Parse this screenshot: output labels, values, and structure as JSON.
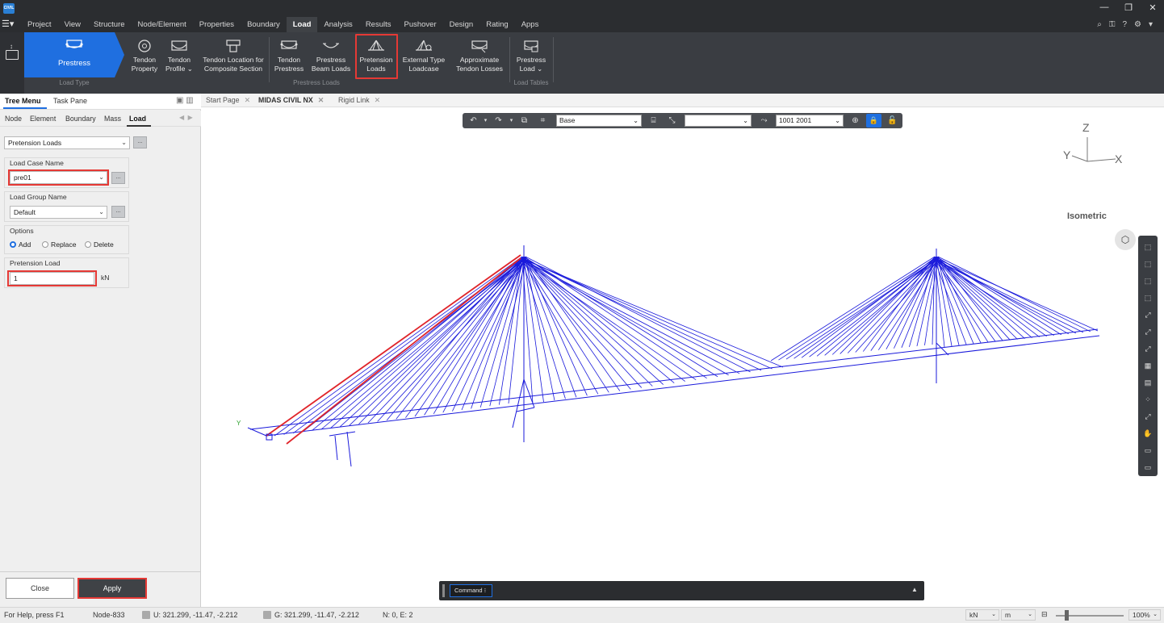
{
  "window": {
    "logo_text": "CIVIL",
    "controls": [
      "—",
      "❐",
      "✕"
    ]
  },
  "menu": {
    "tabs": [
      "Project",
      "View",
      "Structure",
      "Node/Element",
      "Properties",
      "Boundary",
      "Load",
      "Analysis",
      "Results",
      "Pushover",
      "Design",
      "Rating",
      "Apps"
    ],
    "active": "Load"
  },
  "ribbon": {
    "prestress": "Prestress",
    "load_type_group": "Load Type",
    "prestress_loads_group": "Prestress Loads",
    "load_tables_group": "Load Tables",
    "buttons": {
      "tendon_property": [
        "Tendon",
        "Property"
      ],
      "tendon_profile": [
        "Tendon",
        "Profile ⌄"
      ],
      "tendon_location": [
        "Tendon Location for",
        "Composite Section"
      ],
      "tendon_prestress": [
        "Tendon",
        "Prestress"
      ],
      "prestress_beam": [
        "Prestress",
        "Beam Loads"
      ],
      "pretension": [
        "Pretension",
        "Loads"
      ],
      "external_type": [
        "External Type",
        "Loadcase"
      ],
      "approx_losses": [
        "Approximate",
        "Tendon Losses"
      ],
      "prestress_load": [
        "Prestress",
        "Load ⌄"
      ]
    }
  },
  "left_panel": {
    "tabs": {
      "tree_menu": "Tree Menu",
      "task_pane": "Task Pane"
    },
    "sub_tabs": [
      "Node",
      "Element",
      "Boundary",
      "Mass",
      "Load"
    ],
    "active_sub_tab": "Load",
    "load_type_select": "Pretension Loads",
    "load_case_label": "Load Case Name",
    "load_case_value": "pre01",
    "load_group_label": "Load Group Name",
    "load_group_value": "Default",
    "options_label": "Options",
    "options": [
      "Add",
      "Replace",
      "Delete"
    ],
    "selected_option": "Add",
    "pretension_label": "Pretension Load",
    "pretension_value": "1",
    "pretension_unit": "kN",
    "dots": "...",
    "close": "Close",
    "apply": "Apply"
  },
  "doc_tabs": [
    "Start Page",
    "MIDAS CIVIL NX",
    "Rigid Link"
  ],
  "viewport": {
    "toolbar": {
      "layer": "Base",
      "filter": "",
      "nodes": "1001 2001"
    },
    "view_name": "Isometric",
    "axis": {
      "z": "Z",
      "y": "Y",
      "x": "X",
      "origin_y": "Y"
    }
  },
  "command": {
    "label": "Command"
  },
  "status": {
    "help": "For Help, press F1",
    "node": "Node-833",
    "u": "U: 321.299, -11.47, -2.212",
    "g": "G: 321.299, -11.47, -2.212",
    "ne": "N: 0, E: 2",
    "force_unit": "kN",
    "length_unit": "m",
    "zoom": "100%"
  },
  "colors": {
    "accent": "#1f6fe0",
    "highlight": "#e53935",
    "cable": "#1a1adb",
    "selected_cable": "#e0242a"
  }
}
